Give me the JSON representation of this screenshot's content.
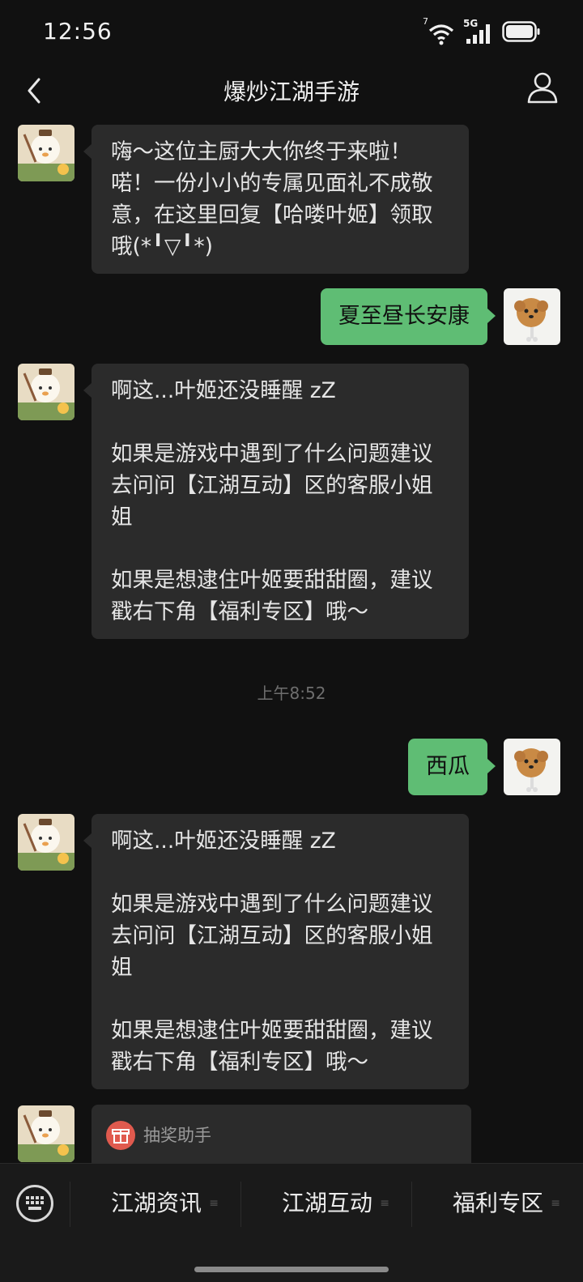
{
  "status_bar": {
    "time": "12:56",
    "network": "5G",
    "wifi_badge": "7"
  },
  "nav": {
    "title": "爆炒江湖手游"
  },
  "messages": {
    "m1": "嗨～这位主厨大大你终于来啦！\n喏！一份小小的专属见面礼不成敬意，在这里回复【哈喽叶姬】领取哦(*╹▽╹*)",
    "m2": "夏至昼长安康",
    "m3": "啊这...叶姬还没睡醒 zZ\n\n如果是游戏中遇到了什么问题建议去问问【江湖互动】区的客服小姐姐\n\n如果是想逮住叶姬要甜甜圈，建议戳右下角【福利专区】哦～",
    "timestamp": "上午8:52",
    "m4": "西瓜",
    "m5": "啊这...叶姬还没睡醒 zZ\n\n如果是游戏中遇到了什么问题建议去问问【江湖互动】区的客服小姐姐\n\n如果是想逮住叶姬要甜甜圈，建议戳右下角【福利专区】哦～",
    "card_label": "抽奖助手"
  },
  "menu": {
    "item1": "江湖资讯",
    "item2": "江湖互动",
    "item3": "福利专区"
  },
  "colors": {
    "background": "#111111",
    "bubble_in": "#2b2b2b",
    "bubble_out": "#5fbd74"
  }
}
